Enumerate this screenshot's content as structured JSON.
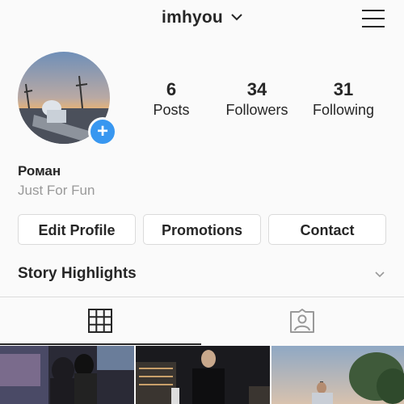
{
  "header": {
    "username": "imhyou",
    "username_chevron_icon": "chevron-down-icon",
    "menu_icon": "hamburger-menu-icon"
  },
  "profile": {
    "avatar_icon": "avatar",
    "add_story_icon": "plus-icon",
    "stats": [
      {
        "value": "6",
        "label": "Posts"
      },
      {
        "value": "34",
        "label": "Followers"
      },
      {
        "value": "31",
        "label": "Following"
      }
    ],
    "full_name": "Роман",
    "bio": "Just For Fun"
  },
  "actions": {
    "edit_profile": "Edit Profile",
    "promotions": "Promotions",
    "contact": "Contact"
  },
  "highlights": {
    "title": "Story Highlights",
    "chevron_icon": "chevron-down-icon"
  },
  "tabs": [
    {
      "icon": "grid-icon",
      "active": true
    },
    {
      "icon": "tagged-person-icon",
      "active": false
    }
  ],
  "colors": {
    "accent": "#3897f0",
    "text": "#262626",
    "muted": "#999999",
    "border": "#dbdbdb",
    "background": "#fafafa"
  }
}
